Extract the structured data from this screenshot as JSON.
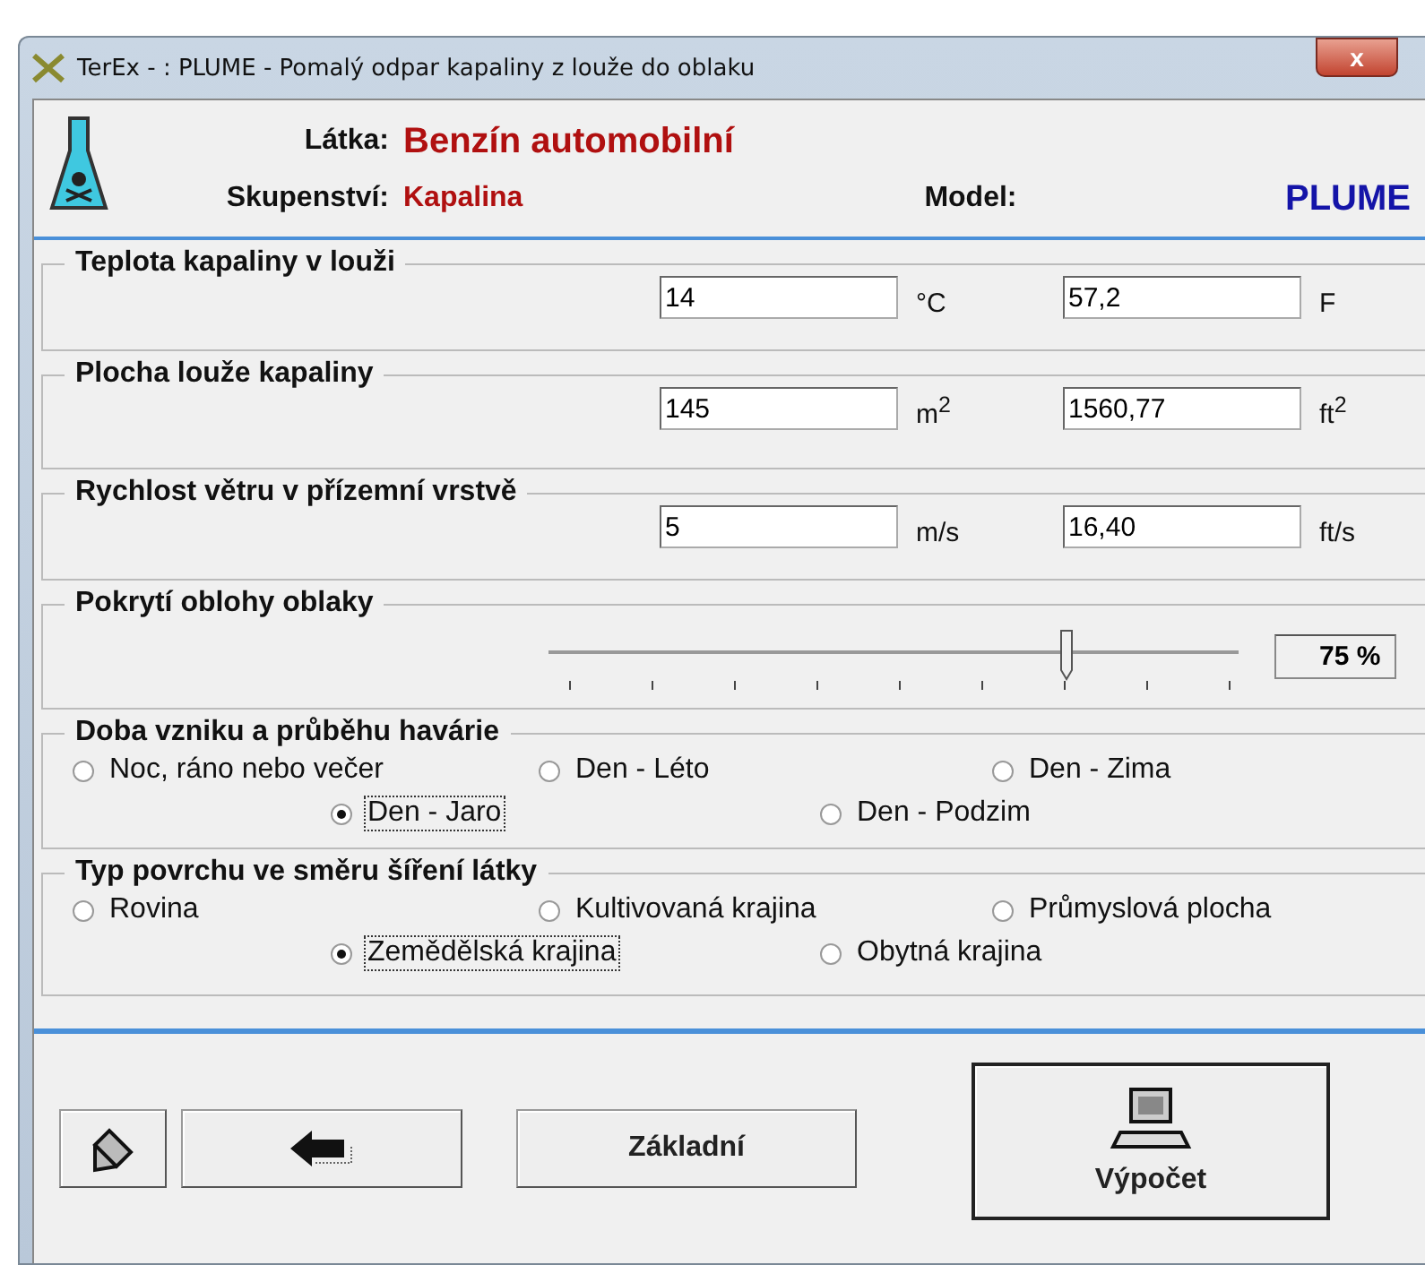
{
  "window": {
    "title": "TerEx - : PLUME - Pomalý odpar kapaliny z louže do oblaku",
    "close": "x"
  },
  "header": {
    "substance_label": "Látka:",
    "substance": "Benzín automobilní",
    "state_label": "Skupenství:",
    "state": "Kapalina",
    "model_label": "Model:",
    "model": "PLUME"
  },
  "inputs": [
    {
      "title": "Teplota kapaliny v louži",
      "value": "14",
      "unit": "°C",
      "value2": "57,2",
      "unit2": "F"
    },
    {
      "title": "Plocha louže kapaliny",
      "value": "145",
      "unit": "m$^{2}$",
      "value2": "1560,77",
      "unit2": "ft$^{2}$"
    },
    {
      "title": "Rychlost větru v přízemní vrstvě",
      "value": "5",
      "unit": "m/s",
      "value2": "16,40",
      "unit2": "ft/s"
    }
  ],
  "cloud": {
    "title": "Pokrytí oblohy oblaky",
    "level": 0.75,
    "reading": "75 %"
  },
  "time": {
    "title": "Doba vzniku a průběhu havárie",
    "rows": [
      [
        {
          "label": "Noc, ráno nebo večer",
          "selected": false
        },
        {
          "label": "Den - Léto",
          "selected": false
        },
        {
          "label": "Den - Zima",
          "selected": false
        }
      ],
      [
        {
          "label": "Den - Jaro",
          "selected": true
        },
        {
          "label": "Den - Podzim",
          "selected": false
        }
      ]
    ]
  },
  "surface": {
    "title": "Typ povrchu ve směru šíření látky",
    "rows": [
      [
        {
          "label": "Rovina",
          "selected": false
        },
        {
          "label": "Kultivovaná krajina",
          "selected": false
        },
        {
          "label": "Průmyslová plocha",
          "selected": false
        }
      ],
      [
        {
          "label": "Zemědělská krajina",
          "selected": true
        },
        {
          "label": "Obytná krajina",
          "selected": false
        }
      ]
    ]
  },
  "buttons": {
    "basic": "Základní",
    "compute": "Výpočet"
  }
}
